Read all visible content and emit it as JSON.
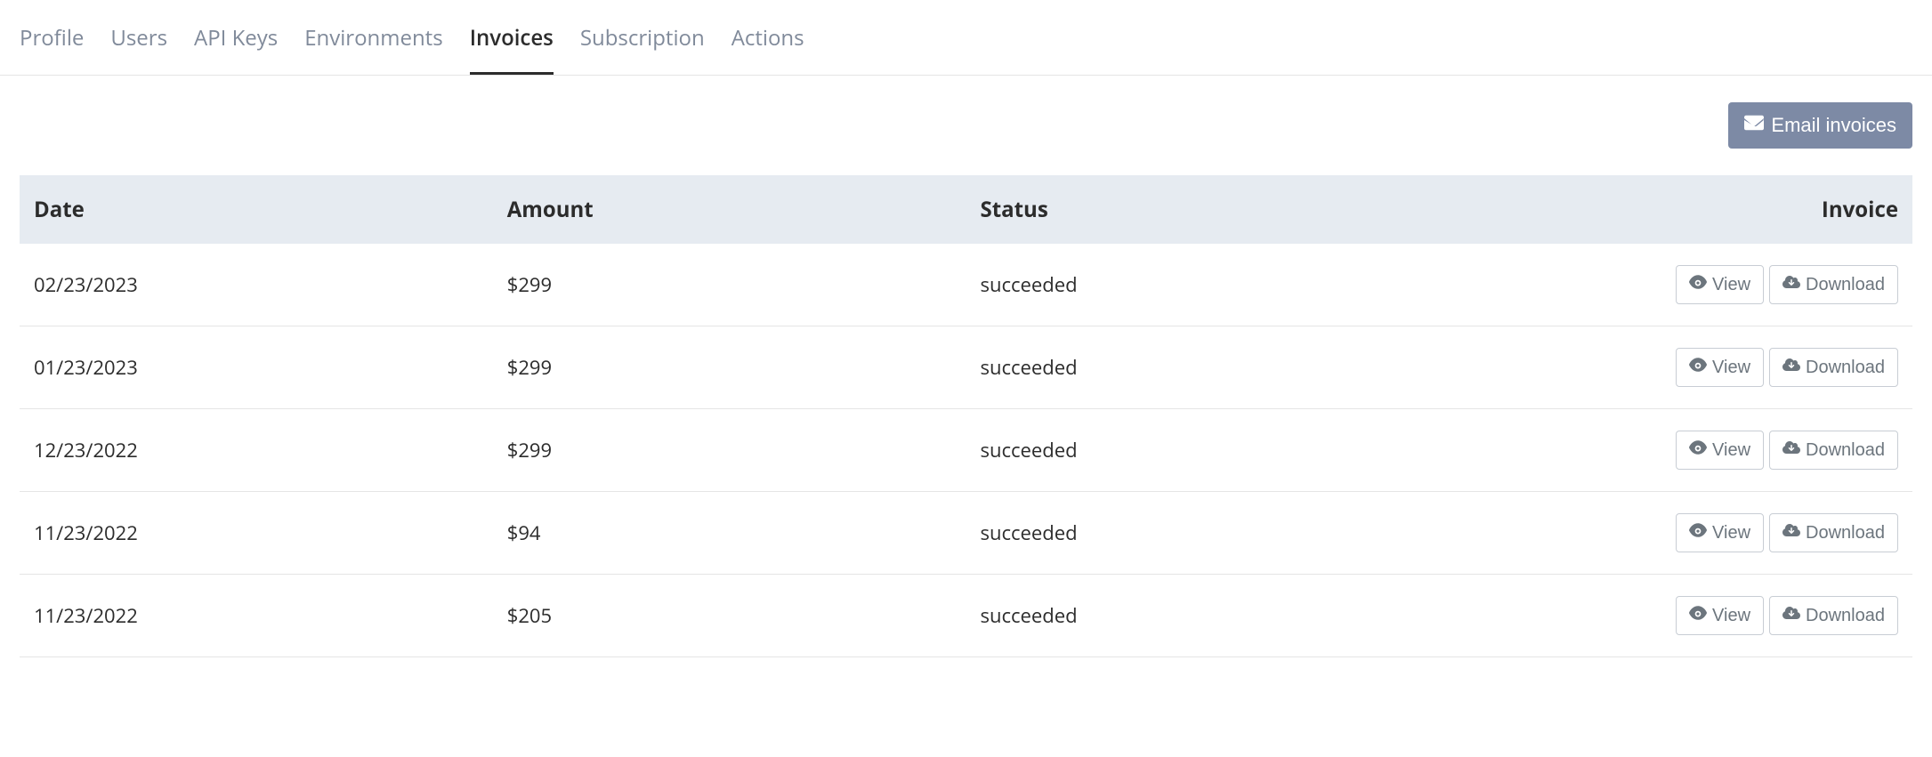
{
  "tabs": [
    {
      "label": "Profile",
      "active": false
    },
    {
      "label": "Users",
      "active": false
    },
    {
      "label": "API Keys",
      "active": false
    },
    {
      "label": "Environments",
      "active": false
    },
    {
      "label": "Invoices",
      "active": true
    },
    {
      "label": "Subscription",
      "active": false
    },
    {
      "label": "Actions",
      "active": false
    }
  ],
  "buttons": {
    "email_invoices": "Email invoices",
    "view": "View",
    "download": "Download"
  },
  "columns": {
    "date": "Date",
    "amount": "Amount",
    "status": "Status",
    "invoice": "Invoice"
  },
  "rows": [
    {
      "date": "02/23/2023",
      "amount": "$299",
      "status": "succeeded"
    },
    {
      "date": "01/23/2023",
      "amount": "$299",
      "status": "succeeded"
    },
    {
      "date": "12/23/2022",
      "amount": "$299",
      "status": "succeeded"
    },
    {
      "date": "11/23/2022",
      "amount": "$94",
      "status": "succeeded"
    },
    {
      "date": "11/23/2022",
      "amount": "$205",
      "status": "succeeded"
    }
  ]
}
